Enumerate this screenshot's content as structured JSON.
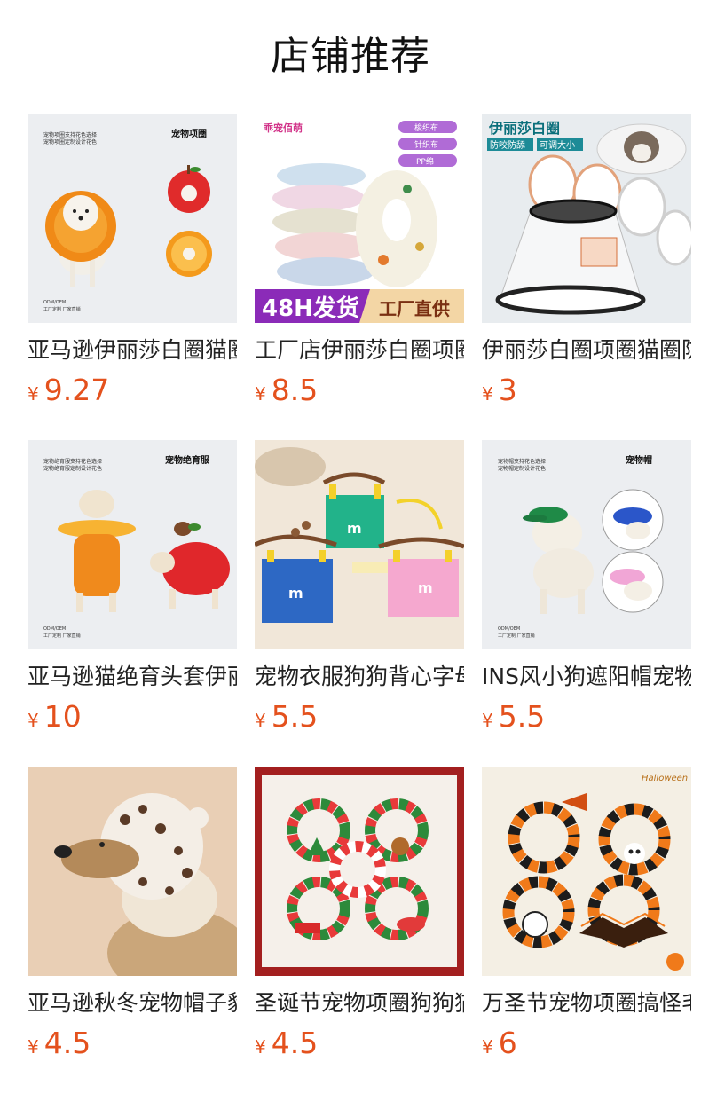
{
  "page": {
    "title": "店铺推荐"
  },
  "colors": {
    "price": "#e4511d",
    "title": "#111111",
    "name": "#222222"
  },
  "products": [
    {
      "name": "亚马逊伊丽莎白圈猫圈狗圈宠物项圈",
      "currency": "¥",
      "price": "9.27",
      "image_texts": [
        "宠物项圈",
        "宠物项圈支持花色选择",
        "宠物项圈定制设计花色",
        "ODM/OEM",
        "工厂定制 厂家直销"
      ]
    },
    {
      "name": "工厂店伊丽莎白圈项圈宠物防舔",
      "currency": "¥",
      "price": "8.5",
      "image_texts": [
        "乖宠佰萌",
        "梭织布",
        "针织布",
        "PP绵",
        "48H发货",
        "工厂直供"
      ]
    },
    {
      "name": "伊丽莎白圈项圈猫圈防咬防舔",
      "currency": "¥",
      "price": "3",
      "image_texts": [
        "伊丽莎白圈",
        "防咬防舔",
        "可调大小"
      ]
    },
    {
      "name": "亚马逊猫绝育头套伊丽莎白圈",
      "currency": "¥",
      "price": "10",
      "image_texts": [
        "宠物绝育服",
        "宠物绝育服支持花色选择",
        "宠物绝育服定制设计花色",
        "ODM/OEM",
        "工厂定制 厂家直销"
      ]
    },
    {
      "name": "宠物衣服狗狗背心字母m背带裤",
      "currency": "¥",
      "price": "5.5",
      "image_texts": [
        "m",
        "m",
        "m"
      ]
    },
    {
      "name": "INS风小狗遮阳帽宠物帽子",
      "currency": "¥",
      "price": "5.5",
      "image_texts": [
        "宠物帽",
        "宠物帽支持花色选择",
        "宠物帽定制设计花色",
        "ODM/OEM",
        "工厂定制 厂家直销"
      ]
    },
    {
      "name": "亚马逊秋冬宠物帽子豹纹保暖",
      "currency": "¥",
      "price": "4.5",
      "image_texts": []
    },
    {
      "name": "圣诞节宠物项圈狗狗猫咪毛球",
      "currency": "¥",
      "price": "4.5",
      "image_texts": []
    },
    {
      "name": "万圣节宠物项圈搞怪毛球猫咪",
      "currency": "¥",
      "price": "6",
      "image_texts": [
        "Halloween"
      ]
    }
  ]
}
